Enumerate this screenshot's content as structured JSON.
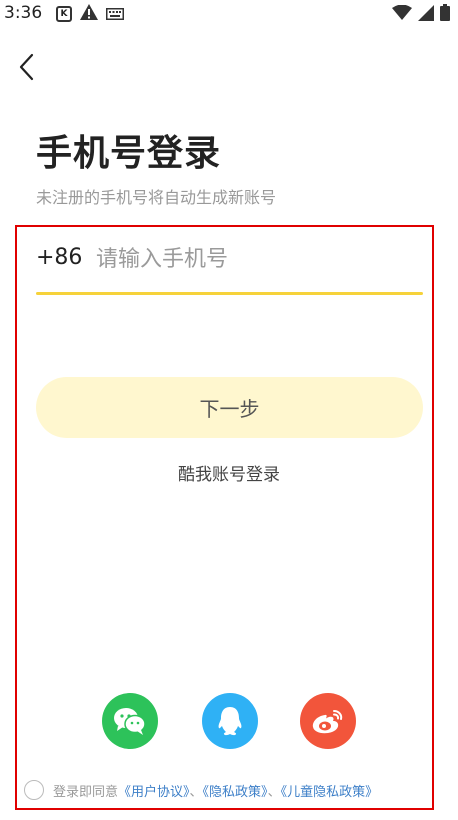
{
  "status_bar": {
    "time": "3:36",
    "left_icons": [
      "app-notification-icon",
      "warning-icon",
      "keyboard-icon"
    ],
    "right_icons": [
      "wifi-icon",
      "signal-icon",
      "battery-icon"
    ]
  },
  "header": {
    "back_icon": "chevron-left-icon"
  },
  "login": {
    "title": "手机号登录",
    "subtitle": "未注册的手机号将自动生成新账号",
    "country_code": "+86",
    "phone_placeholder": "请输入手机号",
    "phone_value": "",
    "next_label": "下一步",
    "alt_login_label": "酷我账号登录"
  },
  "social": {
    "items": [
      {
        "name": "wechat",
        "icon": "wechat-icon",
        "color": "#2dc25a"
      },
      {
        "name": "qq",
        "icon": "qq-icon",
        "color": "#2fb1f5"
      },
      {
        "name": "weibo",
        "icon": "weibo-icon",
        "color": "#f2553b"
      }
    ]
  },
  "agreement": {
    "prefix": "登录即同意",
    "user_agreement": "《用户协议》",
    "sep1": "、",
    "privacy_policy": "《隐私政策》",
    "sep2": "、",
    "children_privacy": "《儿童隐私政策》",
    "checked": false
  },
  "colors": {
    "accent_yellow": "#f6d23a",
    "next_button_bg": "#fff7cf",
    "link_blue": "#3d7fc8",
    "highlight_frame": "#e00000"
  }
}
